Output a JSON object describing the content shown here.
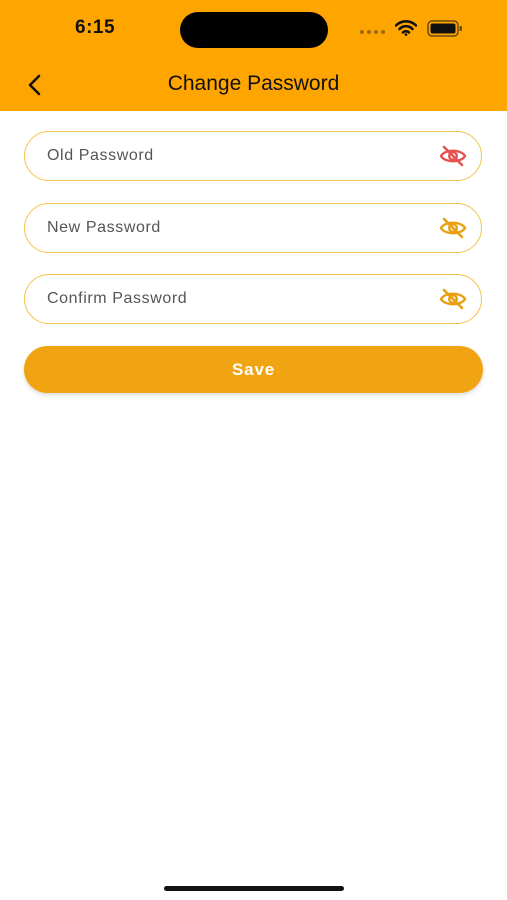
{
  "status_bar": {
    "time": "6:15"
  },
  "header": {
    "title": "Change Password",
    "back_icon": "chevron-left-icon"
  },
  "form": {
    "old_password": {
      "placeholder": "Old Password",
      "value": "",
      "icon": "eye-off-icon",
      "icon_color": "#E85050"
    },
    "new_password": {
      "placeholder": "New Password",
      "value": "",
      "icon": "eye-off-icon",
      "icon_color": "#E8A010"
    },
    "confirm_password": {
      "placeholder": "Confirm Password",
      "value": "",
      "icon": "eye-off-icon",
      "icon_color": "#E8A010"
    },
    "save_label": "Save"
  },
  "colors": {
    "header_bg": "#FFA500",
    "field_border": "#F5C24A",
    "button_bg": "#F0A412"
  }
}
